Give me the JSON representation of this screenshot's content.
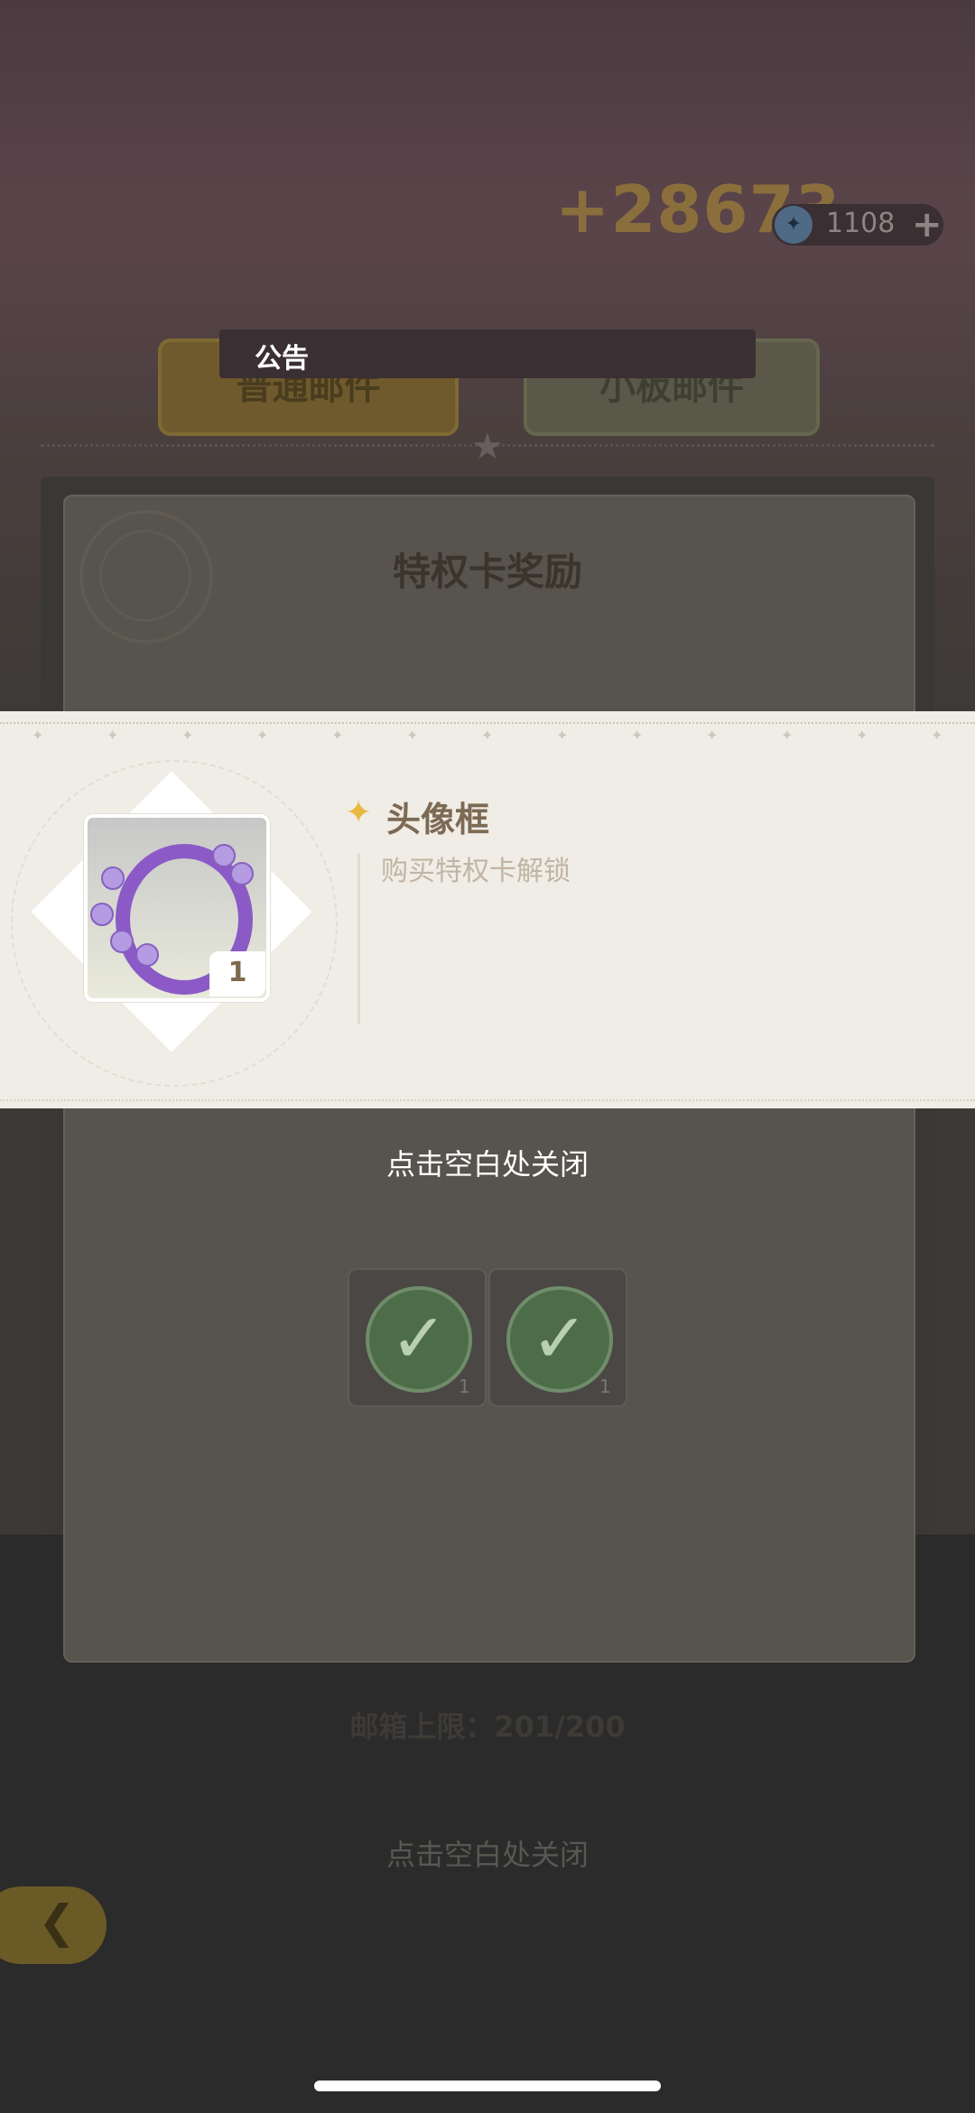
{
  "header": {
    "reward_amount": "+28673",
    "currency_icon": "coin-icon",
    "currency_count": "1108",
    "add_icon": "+"
  },
  "tabs": {
    "normal_mail": "普通邮件",
    "board_mail": "小板邮件"
  },
  "notice": {
    "label": "公告"
  },
  "mail": {
    "title": "特权卡奖励",
    "limit_text": "邮箱上限：201/200",
    "close_hint_bottom": "点击空白处关闭",
    "slots": [
      {
        "icon": "avatar-frame-icon",
        "count": "1",
        "claimed": true
      },
      {
        "icon": "card-frame-icon",
        "count": "1",
        "claimed": true
      }
    ]
  },
  "popup": {
    "item_name": "头像框",
    "item_description": "购买特权卡解锁",
    "item_count": "1",
    "close_hint": "点击空白处关闭"
  },
  "colors": {
    "popup_bg": "#f0ede6",
    "accent_gold": "#e8b840",
    "frame_purple": "#8b5ac6"
  }
}
